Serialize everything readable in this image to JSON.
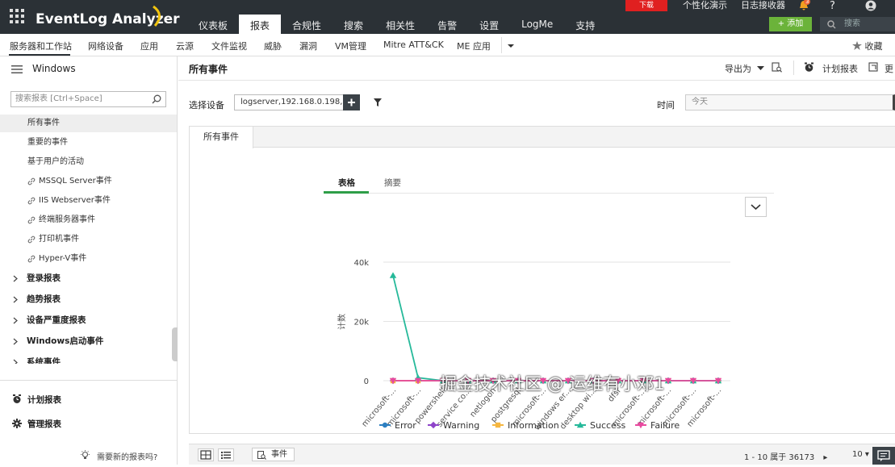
{
  "app": {
    "logo_text": "EventLog Analyzer",
    "download_label": "下载",
    "personalize_label": "个性化演示",
    "log_receiver_label": "日志接收器",
    "alert_count": "3",
    "help_label": "?",
    "add_label": "添加",
    "search_placeholder": "搜索",
    "tabs": [
      "仪表板",
      "报表",
      "合规性",
      "搜索",
      "相关性",
      "告警",
      "设置",
      "LogMe",
      "支持"
    ],
    "active_tab": "报表"
  },
  "subnav": {
    "items": [
      "服务器和工作站",
      "网络设备",
      "应用",
      "云源",
      "文件监视",
      "威胁",
      "漏洞",
      "VM管理",
      "Mitre ATT&CK",
      "ME 应用"
    ],
    "favorites_label": "收藏"
  },
  "sidebar": {
    "title": "Windows",
    "search_placeholder": "搜索报表 [Ctrl+Space]",
    "items": [
      "所有事件",
      "重要的事件",
      "基于用户的活动",
      "MSSQL Server事件",
      "IIS Webserver事件",
      "终端服务器事件",
      "打印机事件",
      "Hyper-V事件"
    ],
    "groups": [
      "登录报表",
      "趋势报表",
      "设备严重度报表",
      "Windows启动事件",
      "系统事件"
    ],
    "scheduled_reports": "计划报表",
    "manage_reports": "管理报表",
    "tip": "需要新的报表吗?"
  },
  "main": {
    "title": "所有事件",
    "export_label": "导出为",
    "schedule_label": "计划报表",
    "more_label": "更",
    "device_label": "选择设备",
    "device_value": "logserver,192.168.0.198,...",
    "time_label": "时间",
    "time_value": "今天",
    "panel_tab": "所有事件",
    "chart_tabs": [
      "表格",
      "摘要"
    ],
    "footer_event": "事件",
    "footer_range": "1 - 10 属于 36173",
    "footer_page_size": "10"
  },
  "watermark": "掘金技术社区 @ 运维有小邓1",
  "colors": {
    "header_bg": "#2b3136",
    "add_green": "#6bb33a",
    "download_red": "#e02020",
    "tab_green": "#2e9e48"
  },
  "chart_data": {
    "type": "line",
    "ylabel": "计数",
    "ylim": [
      0,
      40000
    ],
    "yticks": [
      0,
      20000,
      40000
    ],
    "ytick_labels": [
      "0",
      "20k",
      "40k"
    ],
    "categories": [
      "microsoft-...",
      "microsoft-...",
      "powershell",
      "service co...",
      "netlogon",
      "postgresql",
      "microsoft-...",
      "windows er...",
      "desktop wi...",
      "dfsr",
      "microsoft-...",
      "microsoft-...",
      "microsoft-...",
      "microsoft-..."
    ],
    "series": [
      {
        "name": "Error",
        "color": "#2d7fc1",
        "marker": "circle",
        "values": [
          0,
          0,
          0,
          0,
          0,
          0,
          0,
          0,
          0,
          0,
          0,
          0,
          0,
          0
        ]
      },
      {
        "name": "Warning",
        "color": "#8e44c9",
        "marker": "diamond",
        "values": [
          0,
          0,
          0,
          0,
          0,
          0,
          0,
          0,
          0,
          0,
          0,
          0,
          0,
          0
        ]
      },
      {
        "name": "Information",
        "color": "#f5b640",
        "marker": "square",
        "values": [
          0,
          0,
          0,
          0,
          0,
          0,
          0,
          0,
          0,
          0,
          0,
          0,
          0,
          0
        ]
      },
      {
        "name": "Success",
        "color": "#26b99a",
        "marker": "triangle",
        "values": [
          35500,
          1000,
          0,
          0,
          0,
          0,
          0,
          0,
          0,
          0,
          0,
          0,
          0,
          0
        ]
      },
      {
        "name": "Failure",
        "color": "#e8499f",
        "marker": "triangle-down",
        "values": [
          0,
          0,
          0,
          0,
          0,
          0,
          0,
          0,
          0,
          0,
          0,
          0,
          0,
          0
        ]
      }
    ],
    "legend_position": "bottom",
    "grid": true
  }
}
